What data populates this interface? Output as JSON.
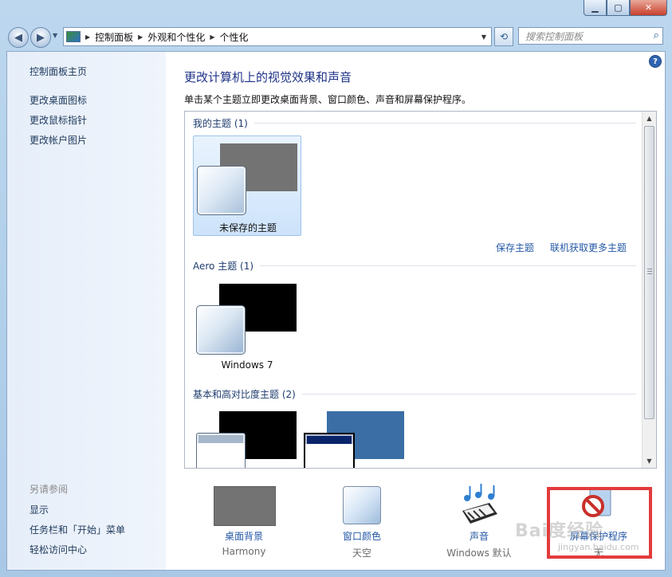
{
  "window": {
    "minimize": "▁",
    "maximize": "▢",
    "close": "✕"
  },
  "address": {
    "crumbs": [
      "控制面板",
      "外观和个性化",
      "个性化"
    ],
    "search_placeholder": "搜索控制面板"
  },
  "sidebar": {
    "items": [
      "控制面板主页",
      "更改桌面图标",
      "更改鼠标指针",
      "更改帐户图片"
    ],
    "see_also": "另请参阅",
    "see_items": [
      "显示",
      "任务栏和「开始」菜单",
      "轻松访问中心"
    ]
  },
  "main": {
    "title": "更改计算机上的视觉效果和声音",
    "description": "单击某个主题立即更改桌面背景、窗口颜色、声音和屏幕保护程序。",
    "help": "?"
  },
  "themes": {
    "my_group": "我的主题 (1)",
    "my_theme": "未保存的主题",
    "save_link": "保存主题",
    "online_link": "联机获取更多主题",
    "aero_group": "Aero 主题 (1)",
    "aero_theme": "Windows 7",
    "basic_group": "基本和高对比度主题 (2)"
  },
  "options": {
    "background_label": "桌面背景",
    "background_value": "Harmony",
    "color_label": "窗口颜色",
    "color_value": "天空",
    "sound_label": "声音",
    "sound_value": "Windows 默认",
    "saver_label": "屏幕保护程序",
    "saver_value": "无"
  },
  "watermark": {
    "main": "Bai度经验",
    "sub": "jingyan.baidu.com"
  },
  "colors": {
    "accent_link": "#2458a6",
    "title": "#1e3287",
    "highlight_frame": "#e23b3b"
  }
}
